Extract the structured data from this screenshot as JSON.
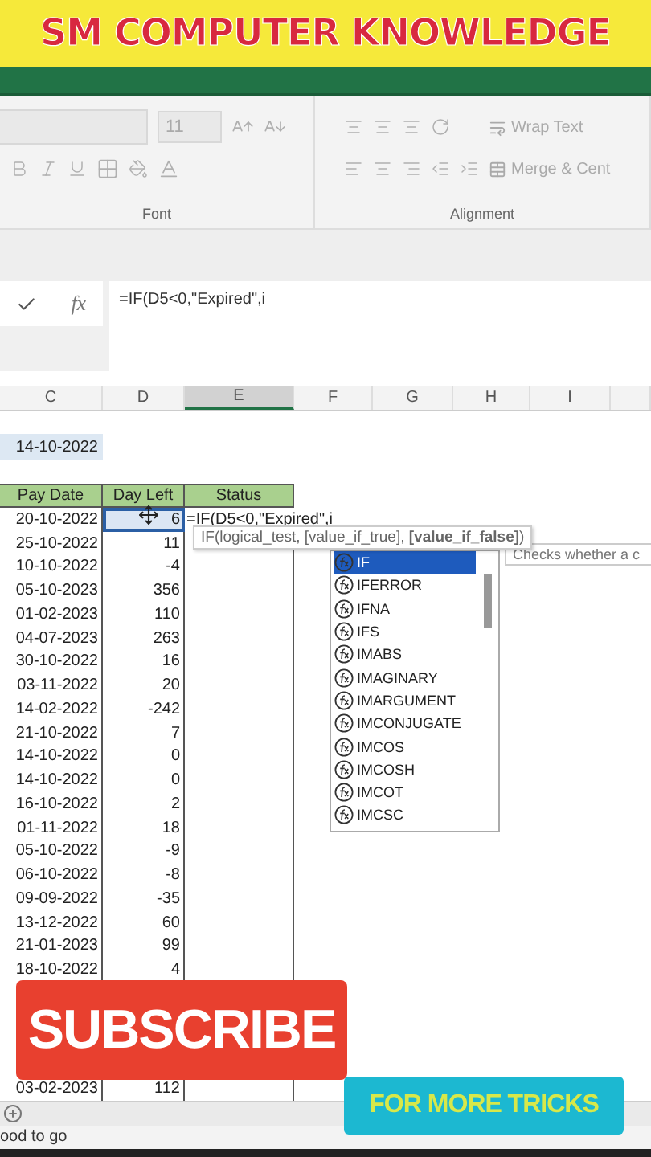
{
  "banner": {
    "title": "SM COMPUTER KNOWLEDGE"
  },
  "ribbon": {
    "font_size": "11",
    "groups": [
      {
        "label": "Font"
      },
      {
        "label": "Alignment"
      }
    ],
    "wrap_text": "Wrap Text",
    "merge": "Merge & Cent"
  },
  "formula_bar": {
    "fx_label": "fx",
    "formula": "=IF(D5<0,\"Expired\",i"
  },
  "columns": [
    {
      "label": "C",
      "selected": false
    },
    {
      "label": "D",
      "selected": false
    },
    {
      "label": "E",
      "selected": true
    },
    {
      "label": "F",
      "selected": false
    },
    {
      "label": "G",
      "selected": false
    },
    {
      "label": "H",
      "selected": false
    },
    {
      "label": "I",
      "selected": false
    }
  ],
  "date_cell": "14-10-2022",
  "table": {
    "headers": [
      "Pay Date",
      "Day Left",
      "Status"
    ],
    "rows": [
      {
        "pay_date": "20-10-2022",
        "day_left": "6",
        "status": "=IF(D5<0,\"Expired\",i",
        "selected": true
      },
      {
        "pay_date": "25-10-2022",
        "day_left": "11",
        "selected": false
      },
      {
        "pay_date": "10-10-2022",
        "day_left": "-4",
        "selected": false
      },
      {
        "pay_date": "05-10-2023",
        "day_left": "356",
        "selected": false
      },
      {
        "pay_date": "01-02-2023",
        "day_left": "110",
        "selected": false
      },
      {
        "pay_date": "04-07-2023",
        "day_left": "263",
        "selected": false
      },
      {
        "pay_date": "30-10-2022",
        "day_left": "16",
        "selected": false
      },
      {
        "pay_date": "03-11-2022",
        "day_left": "20",
        "selected": false
      },
      {
        "pay_date": "14-02-2022",
        "day_left": "-242",
        "selected": false
      },
      {
        "pay_date": "21-10-2022",
        "day_left": "7",
        "selected": false
      },
      {
        "pay_date": "14-10-2022",
        "day_left": "0",
        "selected": false
      },
      {
        "pay_date": "14-10-2022",
        "day_left": "0",
        "selected": false
      },
      {
        "pay_date": "16-10-2022",
        "day_left": "2",
        "selected": false
      },
      {
        "pay_date": "01-11-2022",
        "day_left": "18",
        "selected": false
      },
      {
        "pay_date": "05-10-2022",
        "day_left": "-9",
        "selected": false
      },
      {
        "pay_date": "06-10-2022",
        "day_left": "-8",
        "selected": false
      },
      {
        "pay_date": "09-09-2022",
        "day_left": "-35",
        "selected": false
      },
      {
        "pay_date": "13-12-2022",
        "day_left": "60",
        "selected": false
      },
      {
        "pay_date": "21-01-2023",
        "day_left": "99",
        "selected": false
      },
      {
        "pay_date": "18-10-2022",
        "day_left": "4",
        "selected": false
      }
    ],
    "last_row": {
      "pay_date": "03-02-2023",
      "day_left": "112"
    }
  },
  "tooltip": {
    "text": "IF(logical_test, [value_if_true], **[value_if_false]**)"
  },
  "autocomplete": {
    "items": [
      {
        "label": "IF",
        "selected": true
      },
      {
        "label": "IFERROR",
        "selected": false
      },
      {
        "label": "IFNA",
        "selected": false
      },
      {
        "label": "IFS",
        "selected": false
      },
      {
        "label": "IMABS",
        "selected": false
      },
      {
        "label": "IMAGINARY",
        "selected": false
      },
      {
        "label": "IMARGUMENT",
        "selected": false
      },
      {
        "label": "IMCONJUGATE",
        "selected": false
      },
      {
        "label": "IMCOS",
        "selected": false
      },
      {
        "label": "IMCOSH",
        "selected": false
      },
      {
        "label": "IMCOT",
        "selected": false
      },
      {
        "label": "IMCSC",
        "selected": false
      }
    ]
  },
  "description": "Checks whether a c",
  "overlays": {
    "subscribe": "SUBSCRIBE",
    "more": "FOR MORE TRICKS"
  },
  "status_bar": "ood to go"
}
